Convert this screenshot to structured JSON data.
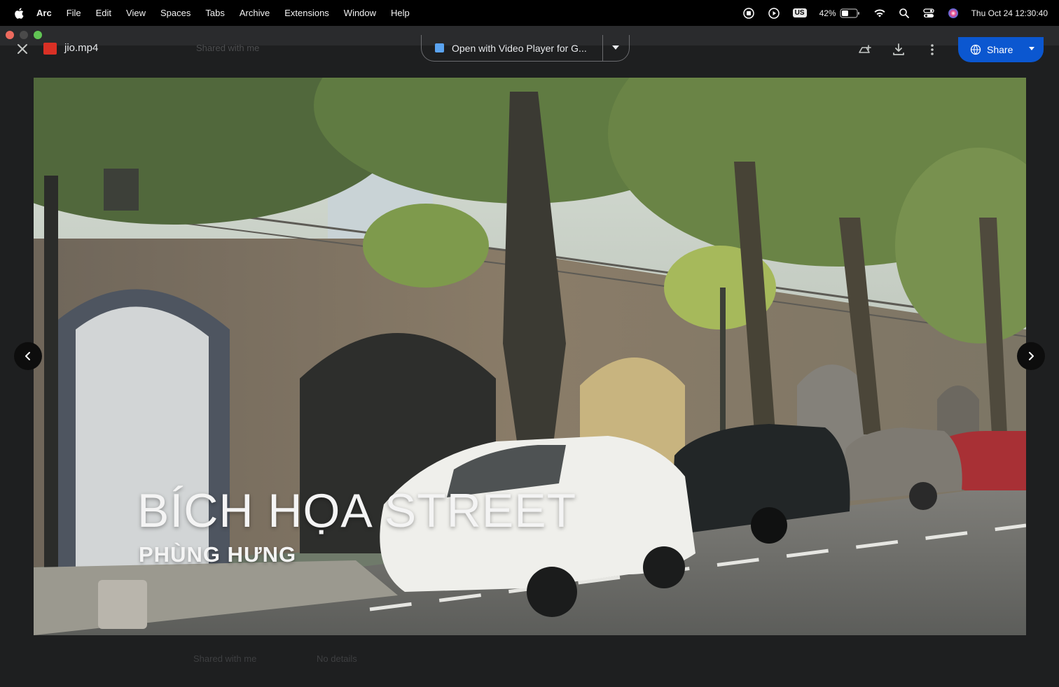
{
  "menubar": {
    "app": "Arc",
    "items": [
      "File",
      "Edit",
      "View",
      "Spaces",
      "Tabs",
      "Archive",
      "Extensions",
      "Window",
      "Help"
    ],
    "status": {
      "keyboard": "US",
      "battery": "42%",
      "clock": "Thu Oct 24  12:30:40"
    }
  },
  "viewer": {
    "file_name": "jio.mp4",
    "faded_label": "Shared with me",
    "open_with": "Open with Video Player for G...",
    "share_label": "Share"
  },
  "video": {
    "caption_title": "BÍCH HỌA STREET",
    "caption_subtitle": "PHÙNG HƯNG"
  },
  "footer": {
    "shared": "Shared with me",
    "size": "No details"
  },
  "colors": {
    "share_button": "#0b57d0",
    "file_icon": "#d93025",
    "background": "#1e1f20"
  }
}
